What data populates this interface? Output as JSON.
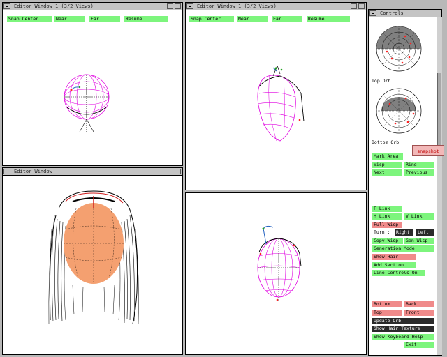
{
  "windows": {
    "top_left": {
      "title": "Editor Window 1 (3/2 Views)"
    },
    "top_middle": {
      "title": "Editor Window 1 (3/2 Views)"
    },
    "bottom_left": {
      "title": "Editor Window"
    },
    "controls": {
      "title": "Controls"
    }
  },
  "view_buttons": {
    "snap_center": "Snap Center",
    "near": "Near",
    "far": "Far",
    "resume": "Resume"
  },
  "controls": {
    "top_orb": "Top Orb",
    "bottom_orb": "Bottom Orb",
    "snapshot": "snapshot",
    "mark_area": "Mark Area",
    "wisp": "Wisp",
    "ring": "Ring",
    "next": "Next",
    "previous": "Previous",
    "f_link": "F Link",
    "h_link": "H Link",
    "v_link": "V Link",
    "full_wisp": "Full Wisp",
    "turn": "Turn :",
    "right": "Right",
    "left": "Left",
    "copy_wisp": "Copy Wisp",
    "gen_wisp": "Gen Wisp",
    "generation_mode": "Generation Mode",
    "show_hair": "Show Hair",
    "add_section": "Add Section",
    "line_controls": "Line Controls On",
    "bottom": "Bottom",
    "back": "Back",
    "top": "Top",
    "front": "Front",
    "update_orb": "Update Orb",
    "show_hair_texture": "Show Hair Texture",
    "show_keyboard_help": "Show Keyboard Help",
    "exit": "Exit"
  },
  "colors": {
    "green_button": "#7df57d",
    "pink_button": "#f08a8a",
    "dark_button": "#2a2a2a",
    "mesh_magenta": "#e000e0",
    "face_skin": "#f4a070",
    "orb_gray": "#808080",
    "control_point_red": "#ff2020"
  }
}
